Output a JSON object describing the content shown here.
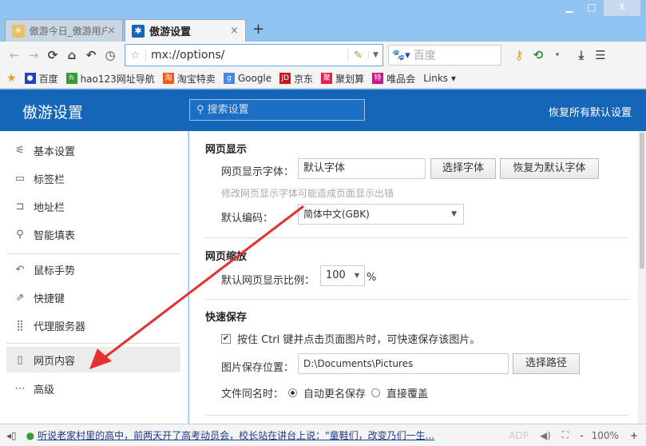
{
  "window": {
    "minimize": "▁",
    "restore": "□",
    "close": "X"
  },
  "tabs": [
    {
      "label": "傲游今日_傲游用户专属的网...",
      "close": "×"
    },
    {
      "label": "傲游设置",
      "close": "×"
    }
  ],
  "new_tab": "+",
  "toolbar": {
    "url": "mx://options/",
    "search_placeholder": "百度"
  },
  "bookmarks": [
    {
      "label": "百度",
      "color": "#2a3fc0",
      "icon": "🐾"
    },
    {
      "label": "hao123网址导航",
      "color": "#3a9a3a",
      "icon": "h"
    },
    {
      "label": "淘宝特卖",
      "color": "#f05a1a",
      "icon": "淘"
    },
    {
      "label": "Google",
      "color": "#4a86e8",
      "icon": "g"
    },
    {
      "label": "京东",
      "color": "#c8161d",
      "icon": "JD"
    },
    {
      "label": "聚划算",
      "color": "#e0224a",
      "icon": "聚"
    },
    {
      "label": "唯品会",
      "color": "#c71585",
      "icon": "特"
    },
    {
      "label": "Links ▾",
      "color": "",
      "icon": ""
    }
  ],
  "header": {
    "title": "傲游设置",
    "search_placeholder": "搜索设置",
    "reset": "恢复所有默认设置"
  },
  "sidebar": [
    {
      "label": "基本设置",
      "icon": "⚟"
    },
    {
      "label": "标签栏",
      "icon": "▭"
    },
    {
      "label": "地址栏",
      "icon": "⊐"
    },
    {
      "label": "智能填表",
      "icon": "⚲"
    },
    {
      "label": "鼠标手势",
      "icon": "↶"
    },
    {
      "label": "快捷键",
      "icon": "⇗"
    },
    {
      "label": "代理服务器",
      "icon": "⣿"
    },
    {
      "label": "网页内容",
      "icon": "▯"
    },
    {
      "label": "高级",
      "icon": "⋯"
    }
  ],
  "main": {
    "display": {
      "title": "网页显示",
      "font_label": "网页显示字体：",
      "font_value": "默认字体",
      "choose_font": "选择字体",
      "reset_font": "恢复为默认字体",
      "hint": "修改网页显示字体可能造成页面显示出错",
      "encoding_label": "默认编码：",
      "encoding_value": "简体中文(GBK)"
    },
    "zoom": {
      "title": "网页缩放",
      "label": "默认网页显示比例：",
      "value": "100",
      "unit": "%"
    },
    "save": {
      "title": "快速保存",
      "checkbox_label": "按住 Ctrl 键并点击页面图片时，可快速保存该图片。",
      "checked": true,
      "path_label": "图片保存位置：",
      "path_value": "D:\\Documents\\Pictures",
      "choose_path": "选择路径",
      "dup_label": "文件同名时：",
      "opt_rename": "自动更名保存",
      "opt_overwrite": "直接覆盖",
      "selected": "自动更名保存"
    }
  },
  "status": {
    "news": "听说老家村里的高中，前两天开了高考动员会，校长站在讲台上说：\"童鞋们，改变乃们一生...",
    "zoom": "100%",
    "minus": "-",
    "plus": "+"
  }
}
